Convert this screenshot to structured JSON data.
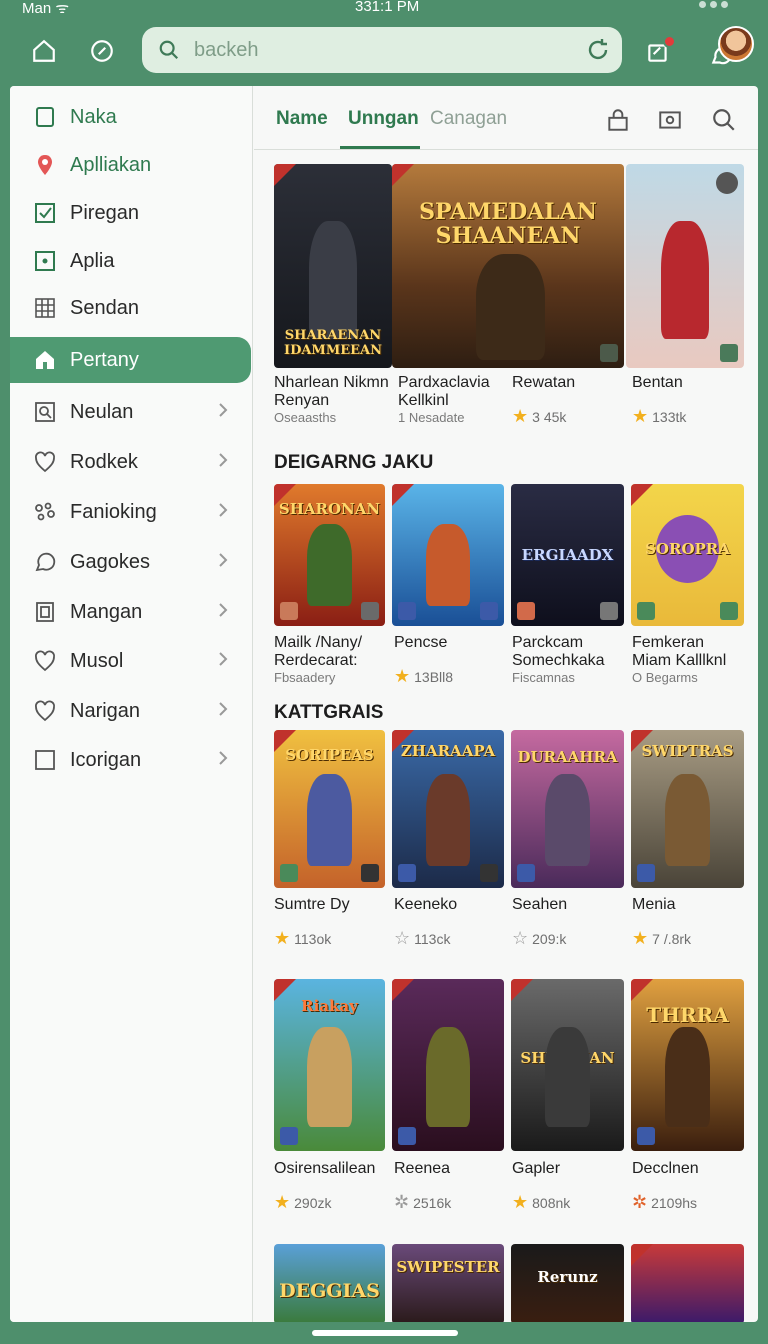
{
  "status": {
    "left": "Man ᯤ",
    "time": "331:1 PM"
  },
  "search": {
    "placeholder": "backeh"
  },
  "sidebar": {
    "items": [
      {
        "label": "Naka",
        "icon": "bookmark-icon"
      },
      {
        "label": "Aplliakan",
        "icon": "location-pin-icon"
      },
      {
        "label": "Piregan",
        "icon": "checkbox-icon"
      },
      {
        "label": "Aplia",
        "icon": "square-dot-icon"
      },
      {
        "label": "Sendan",
        "icon": "grid-icon"
      },
      {
        "label": "Pertany",
        "icon": "home-icon"
      },
      {
        "label": "Neulan",
        "icon": "search-box-icon"
      },
      {
        "label": "Rodkek",
        "icon": "heart-icon"
      },
      {
        "label": "Fanioking",
        "icon": "game-controller-icon"
      },
      {
        "label": "Gagokes",
        "icon": "chat-bubble-icon"
      },
      {
        "label": "Mangan",
        "icon": "book-icon"
      },
      {
        "label": "Musol",
        "icon": "heart-icon"
      },
      {
        "label": "Narigan",
        "icon": "heart-icon"
      },
      {
        "label": "Icorigan",
        "icon": "square-icon"
      }
    ]
  },
  "tabs": [
    "Name",
    "Unngan",
    "Canagan"
  ],
  "featured": {
    "banner_title": "SPAMEDALAN SHAANEAN",
    "left_title": "SHARAENAN IDAMMEEAN",
    "games": [
      {
        "title": "Nharlean Nikmn Renyan",
        "sub": "Oseaasths"
      },
      {
        "title": "Pardxaclavia Kellkinl",
        "sub": "1 Nesadate"
      },
      {
        "title": "Rewatan",
        "rating": "3 45k"
      },
      {
        "title": "Bentan",
        "rating": "133tk"
      }
    ]
  },
  "sections": [
    {
      "heading": "DEIGARNG JAKU",
      "games": [
        {
          "title": "Mailk /Nany/ Rerdecarat:",
          "sub": "Fbsaadery",
          "art": "SHARONAN"
        },
        {
          "title": "Pencse",
          "rating": "13Bll8",
          "art": ""
        },
        {
          "title": "Parckcam Somechkaka",
          "sub": "Fiscamnas",
          "art": "ERGIAADX"
        },
        {
          "title": "Femkeran Miam Kalllknl",
          "sub": "O Begarms",
          "art": "SOROPRA"
        }
      ]
    },
    {
      "heading": "KATTGRAIS",
      "games": [
        {
          "title": "Sumtre Dy",
          "rating": "113ok",
          "art": "SORIPEAS"
        },
        {
          "title": "Keeneko",
          "rating": "113ck",
          "art": "ZHARAAPA"
        },
        {
          "title": "Seahen",
          "rating": "209:k",
          "art": "DURAAHRA"
        },
        {
          "title": "Menia",
          "rating": "7 /.8rk",
          "art": "SWIPTRAS"
        }
      ]
    },
    {
      "heading": "",
      "games": [
        {
          "title": "Osirensalilean",
          "rating": "290zk",
          "art": "Riakay"
        },
        {
          "title": "Reenea",
          "rating": "2516k",
          "art": ""
        },
        {
          "title": "Gapler",
          "rating": "808nk",
          "art": "SHRBAIAN"
        },
        {
          "title": "Decclnen",
          "rating": "2109hs",
          "art": "THRRA"
        }
      ]
    },
    {
      "heading": "",
      "games": [
        {
          "title": "",
          "art": "DEGGIAS"
        },
        {
          "title": "",
          "art": "SWIPESTER"
        },
        {
          "title": "",
          "art": "Rerunz"
        },
        {
          "title": "",
          "art": ""
        }
      ]
    }
  ],
  "colors": {
    "accent": "#2f7a4f",
    "frame": "#4e8f6c",
    "active": "#4f9a72",
    "star": "#f2b01e"
  }
}
